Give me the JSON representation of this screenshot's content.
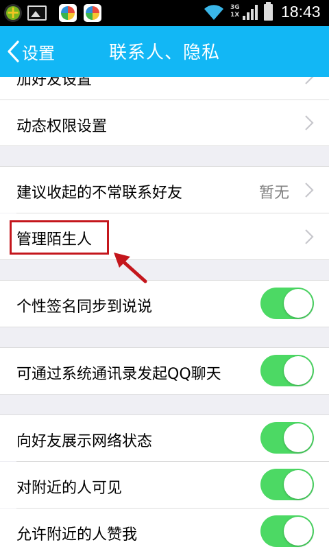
{
  "status_bar": {
    "time": "18:43",
    "network_top": "3G",
    "network_bottom": "1X",
    "icons": [
      "app-icon",
      "gallery-icon",
      "app-store-icon",
      "app-store-icon",
      "wifi-icon",
      "signal-icon",
      "battery-icon"
    ]
  },
  "header": {
    "back_label": "设置",
    "title": "联系人、隐私",
    "background_color": "#12b7f5"
  },
  "rows": {
    "add_friend": {
      "label": "加好友设置"
    },
    "dynamic_permission": {
      "label": "动态权限设置"
    },
    "suggest_collapse": {
      "label": "建议收起的不常联系好友",
      "value": "暂无"
    },
    "manage_strangers": {
      "label": "管理陌生人"
    },
    "signature_sync": {
      "label": "个性签名同步到说说",
      "enabled": true
    },
    "contacts_chat": {
      "label": "可通过系统通讯录发起QQ聊天",
      "enabled": true
    },
    "show_network": {
      "label": "向好友展示网络状态",
      "enabled": true
    },
    "visible_nearby": {
      "label": "对附近的人可见",
      "enabled": true
    },
    "nearby_like": {
      "label": "允许附近的人赞我",
      "enabled": true
    }
  },
  "colors": {
    "toggle_on": "#4cd964",
    "highlight": "#c4161c"
  }
}
